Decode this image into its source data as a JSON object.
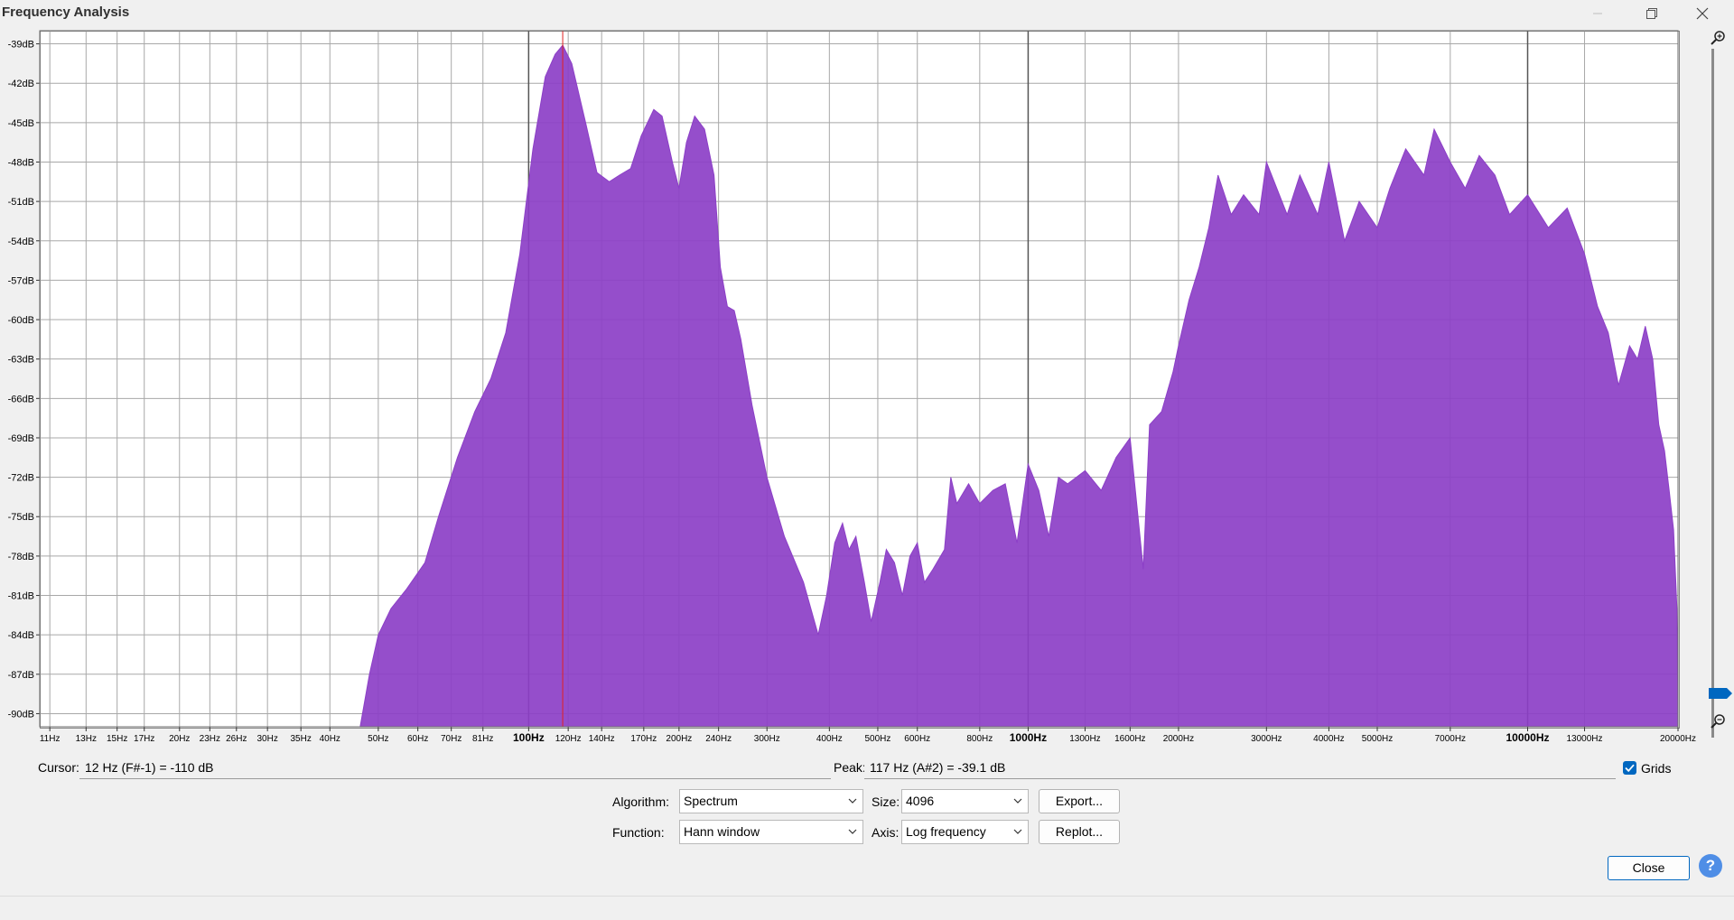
{
  "window": {
    "title": "Frequency Analysis"
  },
  "chart_data": {
    "type": "area",
    "title": "",
    "xlabel": "",
    "ylabel": "",
    "x_scale": "log",
    "x_unit": "Hz",
    "xlim": [
      10.5,
      20000
    ],
    "ylim": [
      -91,
      -38
    ],
    "grid": true,
    "fill_color": "#8c3fc7",
    "cursor_line_color": "#e02020",
    "cursor_line_x": 117,
    "y_ticks": [
      {
        "value": -39,
        "label": "-39dB"
      },
      {
        "value": -42,
        "label": "-42dB"
      },
      {
        "value": -45,
        "label": "-45dB"
      },
      {
        "value": -48,
        "label": "-48dB"
      },
      {
        "value": -51,
        "label": "-51dB"
      },
      {
        "value": -54,
        "label": "-54dB"
      },
      {
        "value": -57,
        "label": "-57dB"
      },
      {
        "value": -60,
        "label": "-60dB"
      },
      {
        "value": -63,
        "label": "-63dB"
      },
      {
        "value": -66,
        "label": "-66dB"
      },
      {
        "value": -69,
        "label": "-69dB"
      },
      {
        "value": -72,
        "label": "-72dB"
      },
      {
        "value": -75,
        "label": "-75dB"
      },
      {
        "value": -78,
        "label": "-78dB"
      },
      {
        "value": -81,
        "label": "-81dB"
      },
      {
        "value": -84,
        "label": "-84dB"
      },
      {
        "value": -87,
        "label": "-87dB"
      },
      {
        "value": -90,
        "label": "-90dB"
      }
    ],
    "x_ticks": [
      {
        "value": 11,
        "label": "11Hz",
        "major": false
      },
      {
        "value": 13,
        "label": "13Hz",
        "major": false
      },
      {
        "value": 15,
        "label": "15Hz",
        "major": false
      },
      {
        "value": 17,
        "label": "17Hz",
        "major": false
      },
      {
        "value": 20,
        "label": "20Hz",
        "major": false
      },
      {
        "value": 23,
        "label": "23Hz",
        "major": false
      },
      {
        "value": 26,
        "label": "26Hz",
        "major": false
      },
      {
        "value": 30,
        "label": "30Hz",
        "major": false
      },
      {
        "value": 35,
        "label": "35Hz",
        "major": false
      },
      {
        "value": 40,
        "label": "40Hz",
        "major": false
      },
      {
        "value": 50,
        "label": "50Hz",
        "major": false
      },
      {
        "value": 60,
        "label": "60Hz",
        "major": false
      },
      {
        "value": 70,
        "label": "70Hz",
        "major": false
      },
      {
        "value": 81,
        "label": "81Hz",
        "major": false
      },
      {
        "value": 100,
        "label": "100Hz",
        "major": true
      },
      {
        "value": 120,
        "label": "120Hz",
        "major": false
      },
      {
        "value": 140,
        "label": "140Hz",
        "major": false
      },
      {
        "value": 170,
        "label": "170Hz",
        "major": false
      },
      {
        "value": 200,
        "label": "200Hz",
        "major": false
      },
      {
        "value": 240,
        "label": "240Hz",
        "major": false
      },
      {
        "value": 300,
        "label": "300Hz",
        "major": false
      },
      {
        "value": 400,
        "label": "400Hz",
        "major": false
      },
      {
        "value": 500,
        "label": "500Hz",
        "major": false
      },
      {
        "value": 600,
        "label": "600Hz",
        "major": false
      },
      {
        "value": 800,
        "label": "800Hz",
        "major": false
      },
      {
        "value": 1000,
        "label": "1000Hz",
        "major": true
      },
      {
        "value": 1300,
        "label": "1300Hz",
        "major": false
      },
      {
        "value": 1600,
        "label": "1600Hz",
        "major": false
      },
      {
        "value": 2000,
        "label": "2000Hz",
        "major": false
      },
      {
        "value": 3000,
        "label": "3000Hz",
        "major": false
      },
      {
        "value": 4000,
        "label": "4000Hz",
        "major": false
      },
      {
        "value": 5000,
        "label": "5000Hz",
        "major": false
      },
      {
        "value": 7000,
        "label": "7000Hz",
        "major": false
      },
      {
        "value": 10000,
        "label": "10000Hz",
        "major": true
      },
      {
        "value": 13000,
        "label": "13000Hz",
        "major": false
      },
      {
        "value": 20000,
        "label": "20000Hz",
        "major": false
      }
    ],
    "series": [
      {
        "values": [
          [
            46,
            -91
          ],
          [
            48,
            -87
          ],
          [
            50,
            -84
          ],
          [
            53,
            -82
          ],
          [
            57,
            -80.5
          ],
          [
            62,
            -78.5
          ],
          [
            66,
            -75
          ],
          [
            72,
            -70.5
          ],
          [
            78,
            -67
          ],
          [
            84,
            -64.5
          ],
          [
            90,
            -61
          ],
          [
            96,
            -55
          ],
          [
            102,
            -47
          ],
          [
            108,
            -41.5
          ],
          [
            113,
            -39.8
          ],
          [
            117,
            -39.1
          ],
          [
            122,
            -40.5
          ],
          [
            130,
            -45
          ],
          [
            137,
            -48.8
          ],
          [
            145,
            -49.5
          ],
          [
            152,
            -49
          ],
          [
            160,
            -48.5
          ],
          [
            168,
            -46
          ],
          [
            178,
            -44
          ],
          [
            185,
            -44.5
          ],
          [
            194,
            -48
          ],
          [
            200,
            -50
          ],
          [
            207,
            -46.5
          ],
          [
            215,
            -44.5
          ],
          [
            225,
            -45.5
          ],
          [
            235,
            -49
          ],
          [
            242,
            -56
          ],
          [
            250,
            -59
          ],
          [
            258,
            -59.3
          ],
          [
            266,
            -61.5
          ],
          [
            280,
            -66.5
          ],
          [
            300,
            -72
          ],
          [
            325,
            -76.5
          ],
          [
            355,
            -80
          ],
          [
            380,
            -84
          ],
          [
            395,
            -81
          ],
          [
            410,
            -77
          ],
          [
            425,
            -75.5
          ],
          [
            438,
            -77.5
          ],
          [
            452,
            -76.5
          ],
          [
            470,
            -80
          ],
          [
            485,
            -83
          ],
          [
            505,
            -80
          ],
          [
            520,
            -77.5
          ],
          [
            540,
            -78.5
          ],
          [
            560,
            -81
          ],
          [
            580,
            -78
          ],
          [
            600,
            -77
          ],
          [
            620,
            -80
          ],
          [
            645,
            -79
          ],
          [
            680,
            -77.5
          ],
          [
            700,
            -72
          ],
          [
            720,
            -74
          ],
          [
            760,
            -72.5
          ],
          [
            800,
            -74
          ],
          [
            850,
            -73
          ],
          [
            900,
            -72.5
          ],
          [
            950,
            -77
          ],
          [
            1000,
            -71
          ],
          [
            1050,
            -73
          ],
          [
            1100,
            -76.5
          ],
          [
            1150,
            -72
          ],
          [
            1200,
            -72.5
          ],
          [
            1300,
            -71.5
          ],
          [
            1400,
            -73
          ],
          [
            1500,
            -70.5
          ],
          [
            1600,
            -69
          ],
          [
            1700,
            -79
          ],
          [
            1750,
            -68
          ],
          [
            1850,
            -67
          ],
          [
            1950,
            -64
          ],
          [
            2000,
            -62
          ],
          [
            2100,
            -58.5
          ],
          [
            2200,
            -56
          ],
          [
            2300,
            -53
          ],
          [
            2400,
            -49
          ],
          [
            2550,
            -52
          ],
          [
            2700,
            -50.5
          ],
          [
            2900,
            -52
          ],
          [
            3000,
            -48
          ],
          [
            3300,
            -52
          ],
          [
            3500,
            -49
          ],
          [
            3800,
            -52
          ],
          [
            4000,
            -48
          ],
          [
            4300,
            -54
          ],
          [
            4600,
            -51
          ],
          [
            5000,
            -53
          ],
          [
            5300,
            -50
          ],
          [
            5700,
            -47
          ],
          [
            6200,
            -49
          ],
          [
            6500,
            -45.5
          ],
          [
            7000,
            -48
          ],
          [
            7500,
            -50
          ],
          [
            8000,
            -47.5
          ],
          [
            8600,
            -49
          ],
          [
            9200,
            -52
          ],
          [
            10000,
            -50.5
          ],
          [
            11000,
            -53
          ],
          [
            12000,
            -51.5
          ],
          [
            13000,
            -55
          ],
          [
            13800,
            -59
          ],
          [
            14500,
            -61
          ],
          [
            15200,
            -65
          ],
          [
            16000,
            -62
          ],
          [
            16600,
            -63
          ],
          [
            17200,
            -60.5
          ],
          [
            17800,
            -63
          ],
          [
            18300,
            -68
          ],
          [
            18800,
            -70
          ],
          [
            19200,
            -73
          ],
          [
            19600,
            -76
          ],
          [
            19900,
            -82
          ],
          [
            20000,
            -91
          ]
        ]
      }
    ]
  },
  "readouts": {
    "cursor_label": "Cursor:",
    "cursor_value": "12 Hz (F#-1) = -110 dB",
    "peak_label": "Peak:",
    "peak_value": "117 Hz (A#2) = -39.1 dB",
    "grids_label": "Grids",
    "grids_checked": true
  },
  "controls": {
    "algorithm_label": "Algorithm:",
    "algorithm_value": "Spectrum",
    "size_label": "Size:",
    "size_value": "4096",
    "function_label": "Function:",
    "function_value": "Hann window",
    "axis_label": "Axis:",
    "axis_value": "Log frequency",
    "export_label": "Export...",
    "replot_label": "Replot...",
    "close_label": "Close",
    "help_label": "?"
  },
  "colors": {
    "accent": "#0067c0",
    "zoom_slider": "#0067c0"
  },
  "icons": {
    "zoom_in": "zoom-in-icon",
    "zoom_out": "zoom-out-icon",
    "restore": "restore-icon",
    "close": "close-icon",
    "check": "check-icon",
    "chevron": "chevron-down-icon"
  }
}
